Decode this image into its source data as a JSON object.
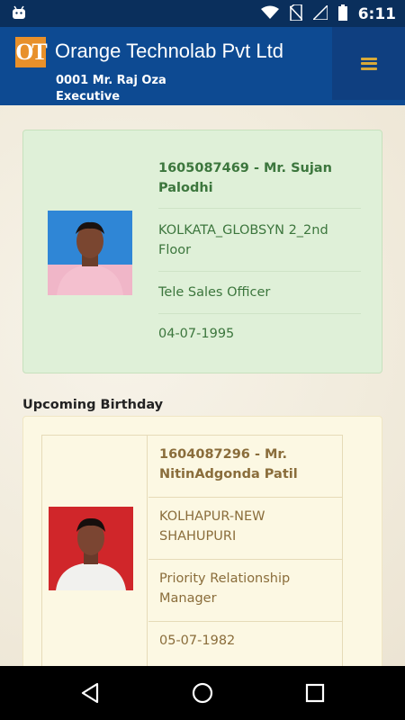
{
  "status_bar": {
    "time": "6:11",
    "icons": [
      "android-icon",
      "wifi-icon",
      "no-sim-icon",
      "signal-icon",
      "battery-icon"
    ]
  },
  "header": {
    "logo_text": "OT",
    "company_name": "Orange Technolab Pvt Ltd",
    "user_id_name": "0001 Mr. Raj Oza",
    "user_role": "Executive",
    "menu_icon": "hamburger-menu-icon"
  },
  "today_card": {
    "id_name": "1605087469 - Mr. Sujan Palodhi",
    "location": "KOLKATA_GLOBSYN 2_2nd Floor",
    "designation": "Tele Sales Officer",
    "date": "04-07-1995"
  },
  "upcoming": {
    "title": "Upcoming Birthday",
    "id_name": "1604087296 - Mr. NitinAdgonda Patil",
    "location": "KOLHAPUR-NEW SHAHUPURI",
    "designation": "Priority Relationship Manager",
    "date": "05-07-1982"
  },
  "nav_bar": {
    "icons": [
      "back-icon",
      "home-icon",
      "recents-icon"
    ]
  },
  "colors": {
    "status_bar": "#0a2f5c",
    "header": "#0d4a92",
    "logo": "#e8902a",
    "success_bg": "#dff0d8",
    "success_text": "#3c763d",
    "warning_bg": "#fcf8e3",
    "warning_text": "#8a6d3b"
  }
}
